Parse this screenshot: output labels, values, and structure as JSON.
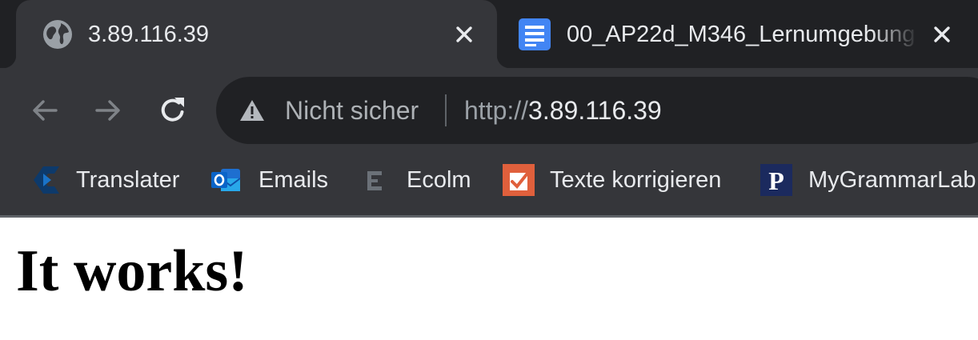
{
  "colors": {
    "tabstrip_bg": "#202124",
    "toolbar_bg": "#35363a",
    "omnibox_bg": "#202124",
    "text_primary": "#e8eaed",
    "text_secondary": "#9aa0a6",
    "docs_blue": "#4285f4",
    "page_bg": "#ffffff"
  },
  "tabs": [
    {
      "title": "3.89.116.39",
      "favicon": "globe-icon",
      "active": true
    },
    {
      "title": "00_AP22d_M346_Lernumgebung",
      "favicon": "google-docs-icon",
      "active": false
    }
  ],
  "toolbar": {
    "back_icon": "arrow-left-icon",
    "forward_icon": "arrow-right-icon",
    "reload_icon": "reload-icon",
    "security_icon": "warning-triangle-icon",
    "security_label": "Nicht sicher",
    "url_scheme": "http://",
    "url_host": "3.89.116.39"
  },
  "bookmarks": [
    {
      "label": "Translater",
      "icon": "translater-icon"
    },
    {
      "label": "Emails",
      "icon": "outlook-icon"
    },
    {
      "label": "Ecolm",
      "icon": "ecolm-icon"
    },
    {
      "label": "Texte korrigieren",
      "icon": "texte-korrigieren-icon"
    },
    {
      "label": "MyGrammarLab",
      "icon": "pearson-icon"
    }
  ],
  "page": {
    "heading": "It works!"
  }
}
